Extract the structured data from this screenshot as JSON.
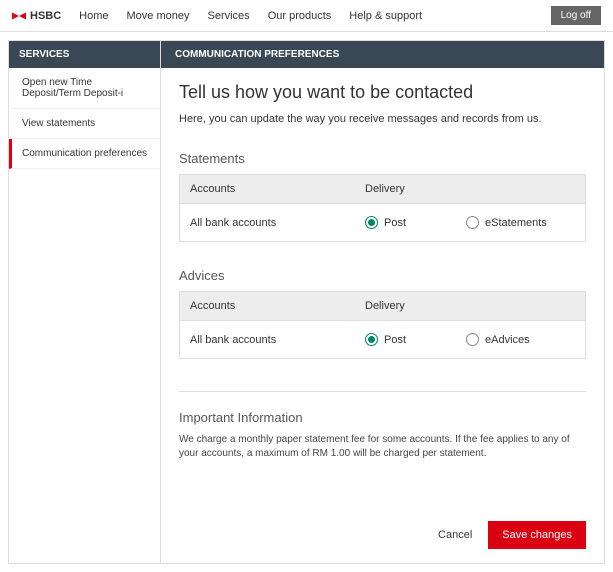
{
  "brand": "HSBC",
  "nav": {
    "home": "Home",
    "move": "Move money",
    "services": "Services",
    "products": "Our products",
    "help": "Help & support"
  },
  "logoff": "Log off",
  "sidebar": {
    "header": "SERVICES",
    "items": [
      "Open new Time Deposit/Term Deposit-i",
      "View statements",
      "Communication preferences"
    ]
  },
  "main": {
    "header": "COMMUNICATION PREFERENCES",
    "title": "Tell us how you want to be contacted",
    "intro": "Here, you can update the way you receive messages and records from us.",
    "statements": {
      "title": "Statements",
      "col_accounts": "Accounts",
      "col_delivery": "Delivery",
      "row_label": "All bank accounts",
      "opt_post": "Post",
      "opt_e": "eStatements"
    },
    "advices": {
      "title": "Advices",
      "col_accounts": "Accounts",
      "col_delivery": "Delivery",
      "row_label": "All bank accounts",
      "opt_post": "Post",
      "opt_e": "eAdvices"
    },
    "important": {
      "title": "Important Information",
      "text": "We charge a monthly paper statement fee for some accounts. If the fee applies to any of your accounts, a maximum of RM 1.00 will be charged per statement."
    },
    "actions": {
      "cancel": "Cancel",
      "save": "Save changes"
    }
  }
}
